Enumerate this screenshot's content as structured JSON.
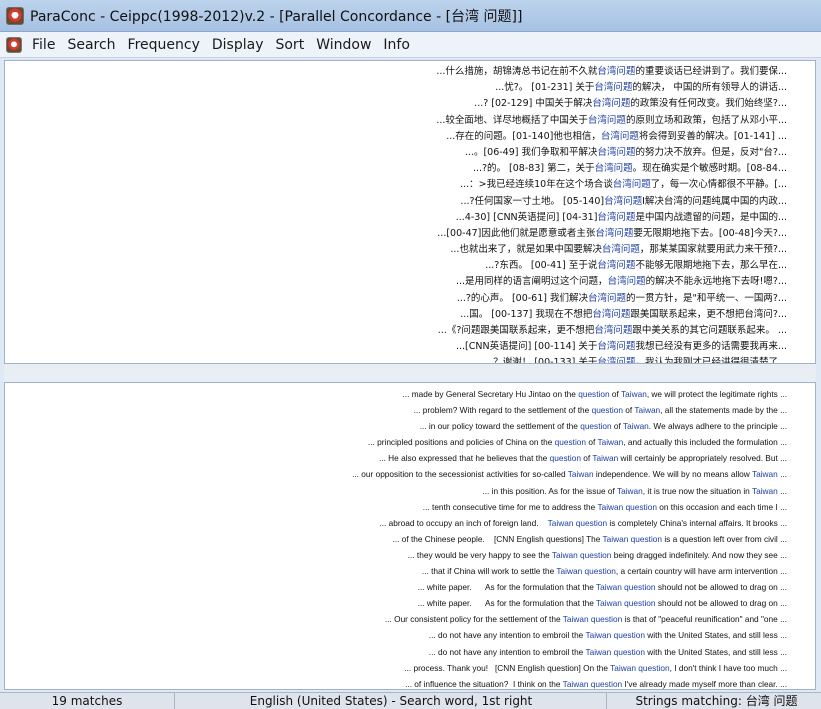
{
  "window": {
    "title": "ParaConc - Ceippc(1998-2012)v.2 - [Parallel Concordance - [台湾 问题]]"
  },
  "menu": [
    "File",
    "Search",
    "Frequency",
    "Display",
    "Sort",
    "Window",
    "Info"
  ],
  "top_pane": {
    "lines": [
      [
        "...什么措施，胡锦涛总书记在前不久就",
        "台湾问题",
        "的重要谈话已经讲到了。我们要保..."
      ],
      [
        "...忧?。 [01-231] 关于",
        "台湾问题",
        "的解决， 中国的所有领导人的讲话..."
      ],
      [
        "...? [02-129] 中国关于解决",
        "台湾问题",
        "的政策没有任何改变。我们始终坚?..."
      ],
      [
        "...较全面地、详尽地概括了中国关于",
        "台湾问题",
        "的原则立场和政策，包括了从邓小平..."
      ],
      [
        "...存在的问题。[01-140]他也相信，",
        "台湾问题",
        "将会得到妥善的解决。[01-141] ..."
      ],
      [
        "...。[06-49] 我们争取和平解决",
        "台湾问题",
        "的努力决不放弃。但是，反对\"台?..."
      ],
      [
        "...?的。 [08-83] 第二，关于",
        "台湾问题",
        "。现在确实是个敏感时期。[08-84..."
      ],
      [
        "...：>我已经连续10年在这个场合谈",
        "台湾问题",
        "了，每一次心情都很不平静。[..."
      ],
      [
        "...?任何国家一寸土地。 [05-140]",
        "台湾问题",
        "I解决台湾的问题纯属中国的内政..."
      ],
      [
        "...4-30] [CNN英语提问] [04-31]",
        "台湾问题",
        "是中国内战遗留的问题，是中国的..."
      ],
      [
        "...[00-47]因此他们就是愿意或者主张",
        "台湾问题",
        "要无限期地拖下去。[00-48]今天?..."
      ],
      [
        "...也就出来了，就是如果中国要解决",
        "台湾问题",
        "，那某某国家就要用武力来干预?..."
      ],
      [
        "...?东西。 [00-41] 至于说",
        "台湾问题",
        "不能够无限期地拖下去，那么早在..."
      ],
      [
        "...是用同样的语言阐明过这个问题，",
        "台湾问题",
        "的解决不能永远地拖下去呀!嗯?..."
      ],
      [
        "...?的心声。 [00-61] 我们解决",
        "台湾问题",
        "的一贯方针，是\"和平统一、一国两?..."
      ],
      [
        "...国。 [00-137] 我现在不想把",
        "台湾问题",
        "跟美国联系起来，更不想把台湾问?..."
      ],
      [
        "...《?问题跟美国联系起来，更不想把",
        "台湾问题",
        "跟中美关系的其它问题联系起来。 ..."
      ],
      [
        "...[CNN英语提问] [00-114] 关于",
        "台湾问题",
        "我想已经没有更多的话需要我再来..."
      ],
      [
        "...？谢谢！ [00-133] 关于",
        "台湾问题",
        "，我认为我刚才已经讲得很清楚了..."
      ]
    ]
  },
  "bottom_pane": {
    "lines": [
      [
        "... made by General Secretary Hu Jintao on the ",
        "question",
        " of ",
        "Taiwan",
        ", we will protect the legitimate rights ..."
      ],
      [
        "... problem? With regard to the settlement of the ",
        "question",
        " of ",
        "Taiwan",
        ", all the statements made by the ..."
      ],
      [
        "... in our policy toward the settlement of the ",
        "question",
        " of ",
        "Taiwan",
        ". We always adhere to the principle ..."
      ],
      [
        "... principled positions and policies of China on the ",
        "question",
        " of ",
        "Taiwan",
        ", and actually this included the formulation ..."
      ],
      [
        "... He also expressed that he believes that the ",
        "question",
        " of ",
        "Taiwan",
        " will certainly be appropriately resolved. But ..."
      ],
      [
        "... our opposition to the secessionist activities for so-called ",
        "Taiwan",
        " independence. We will by no means allow ",
        "Taiwan",
        " ..."
      ],
      [
        "... in this position. As for the issue of ",
        "Taiwan",
        ", it is true now the situation in ",
        "Taiwan",
        " ..."
      ],
      [
        "... tenth consecutive time for me to address the ",
        "Taiwan question",
        " on this occasion and each time I ..."
      ],
      [
        "... abroad to occupy an inch of foreign land.    ",
        "Taiwan question",
        " is completely China's internal affairs. It brooks ..."
      ],
      [
        "... of the Chinese people.    [CNN English questions] The ",
        "Taiwan question",
        " is a question left over from civil ..."
      ],
      [
        "... they would be very happy to see the ",
        "Taiwan question",
        " being dragged indefinitely. And now they see ..."
      ],
      [
        "... that if China will work to settle the ",
        "Taiwan question",
        ", a certain country will have arm intervention ..."
      ],
      [
        "... white paper.      As for the formulation that the ",
        "Taiwan question",
        " should not be allowed to drag on ..."
      ],
      [
        "... white paper.      As for the formulation that the ",
        "Taiwan question",
        " should not be allowed to drag on ..."
      ],
      [
        "... Our consistent policy for the settlement of the ",
        "Taiwan question",
        " is that of \"peaceful reunification\" and \"one ..."
      ],
      [
        "... do not have any intention to embroil the ",
        "Taiwan question",
        " with the United States, and still less ..."
      ],
      [
        "... do not have any intention to embroil the ",
        "Taiwan question",
        " with the United States, and still less ..."
      ],
      [
        "... process. Thank you!   [CNN English question] On the ",
        "Taiwan question",
        ", I don't think I have too much ..."
      ],
      [
        "... of influence the situation?  I think on the ",
        "Taiwan question",
        " I've already made myself more than clear. ..."
      ]
    ]
  },
  "status": {
    "matches": "19 matches",
    "language": "English (United States) - Search word, 1st right",
    "strings": "Strings matching: 台湾 问题"
  },
  "colors": {
    "keyword": "#1d3f9f"
  }
}
